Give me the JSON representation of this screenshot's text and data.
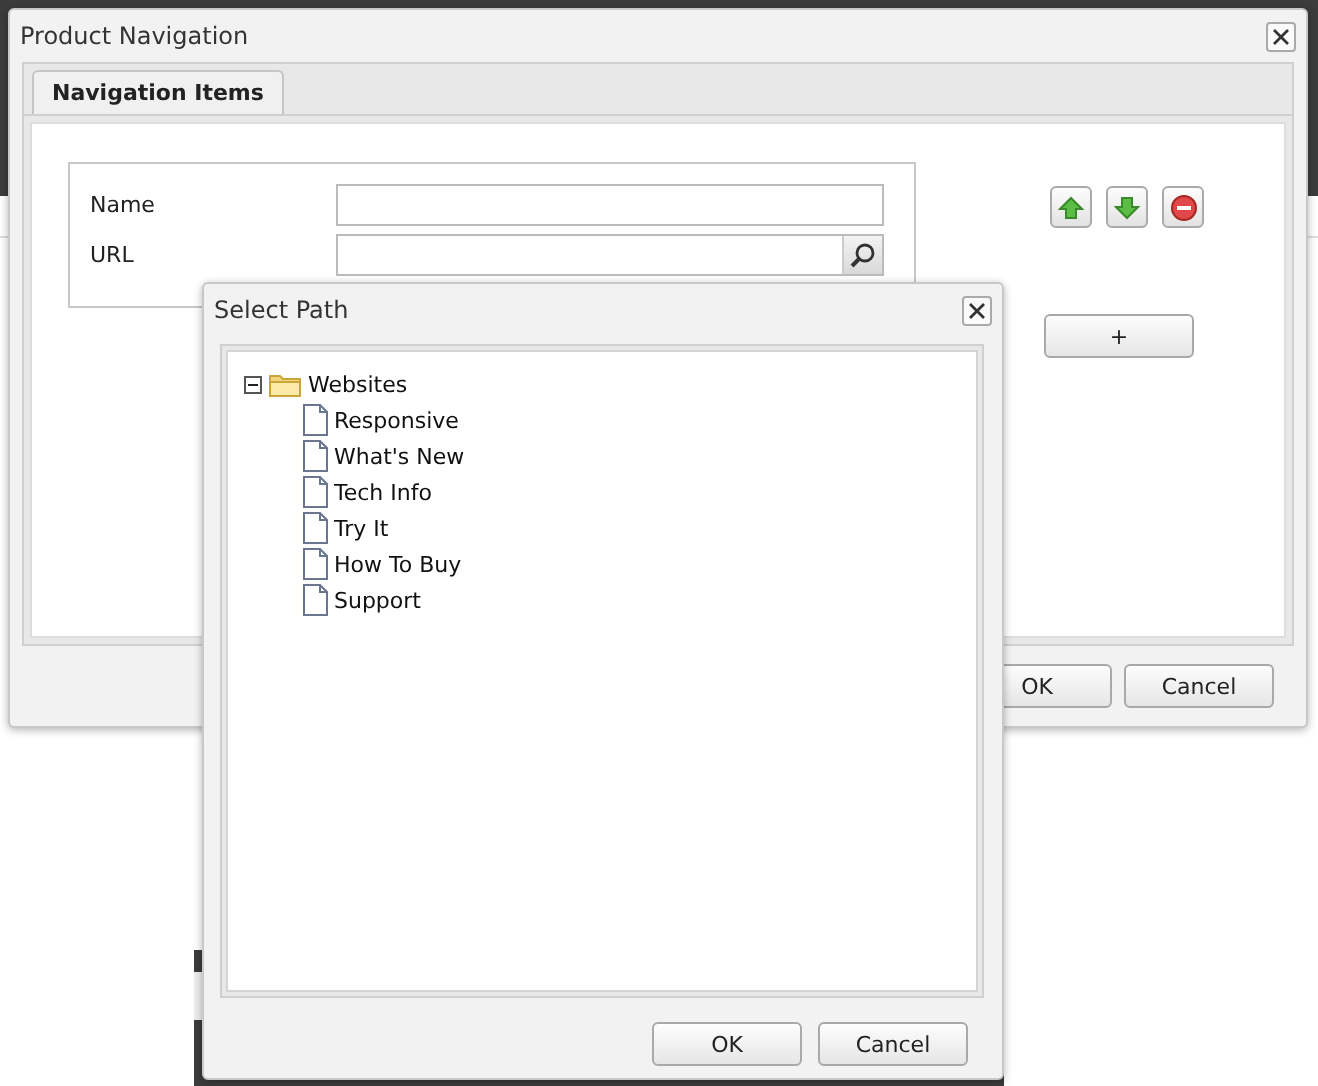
{
  "main_dialog": {
    "title": "Product Navigation",
    "tabs": [
      {
        "label": "Navigation Items",
        "selected": true
      }
    ],
    "fields": [
      {
        "label": "Name",
        "kind": "text"
      },
      {
        "label": "URL",
        "kind": "search"
      }
    ],
    "icon_buttons": [
      {
        "kind": "up"
      },
      {
        "kind": "down"
      },
      {
        "kind": "remove"
      }
    ],
    "add_button": "+",
    "buttons": [
      "OK",
      "Cancel"
    ]
  },
  "select_path": {
    "title": "Select Path",
    "tree": [
      {
        "label": "Websites",
        "kind": "folder",
        "expanded": true,
        "children": [
          {
            "label": "Responsive",
            "kind": "page"
          },
          {
            "label": "What's New",
            "kind": "page"
          },
          {
            "label": "Tech Info",
            "kind": "page"
          },
          {
            "label": "Try It",
            "kind": "page"
          },
          {
            "label": "How To Buy",
            "kind": "page"
          },
          {
            "label": "Support",
            "kind": "page"
          }
        ]
      }
    ],
    "buttons": [
      "OK",
      "Cancel"
    ]
  }
}
